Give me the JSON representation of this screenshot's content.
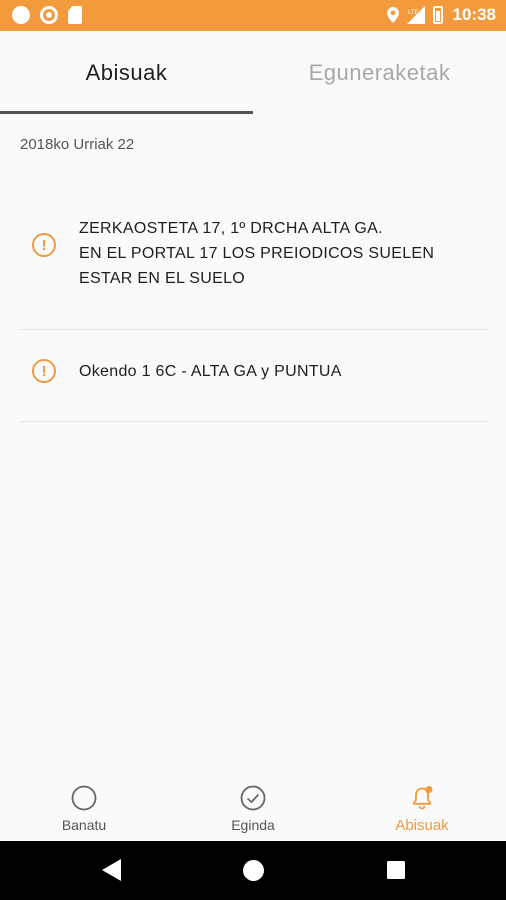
{
  "status_bar": {
    "time": "10:38",
    "network": "LTE"
  },
  "tabs": [
    {
      "label": "Abisuak",
      "active": true
    },
    {
      "label": "Eguneraketak",
      "active": false
    }
  ],
  "date_header": "2018ko Urriak 22",
  "alerts": [
    {
      "icon": "alert-circle-icon",
      "text": "ZERKAOSTETA 17, 1º DRCHA ALTA GA.\nEN EL PORTAL 17 LOS PREIODICOS SUELEN\nESTAR EN EL SUELO"
    },
    {
      "icon": "alert-circle-icon",
      "text": "Okendo 1 6C - ALTA GA y PUNTUA"
    }
  ],
  "bottom_nav": [
    {
      "label": "Banatu",
      "icon": "circle-icon",
      "active": false
    },
    {
      "label": "Eginda",
      "icon": "check-circle-icon",
      "active": false
    },
    {
      "label": "Abisuak",
      "icon": "bell-icon",
      "active": true
    }
  ],
  "colors": {
    "accent": "#f39a3c",
    "status_bar": "#f39a3c",
    "text": "#1e1e1e",
    "inactive_tab": "#a8a8a8"
  }
}
